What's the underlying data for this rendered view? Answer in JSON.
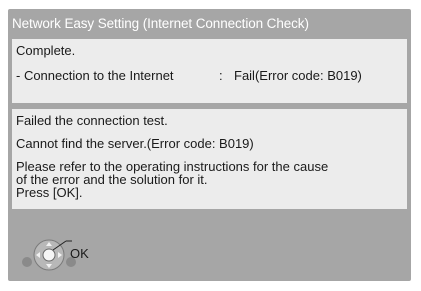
{
  "dialog": {
    "title": "Network Easy Setting (Internet Connection Check)"
  },
  "result_panel": {
    "status": "Complete.",
    "item_label": "- Connection to the Internet",
    "separator": ":",
    "item_value": "Fail(Error code: B019)"
  },
  "message_panel": {
    "line1": "Failed the connection test.",
    "line2": "Cannot find the server.(Error code: B019)",
    "line3": "Please refer to the operating instructions for the cause",
    "line4": "of the error and the solution for it.",
    "line5": "Press [OK]."
  },
  "footer": {
    "ok_label": "OK",
    "remote_icon": "remote-dpad-ok-icon"
  }
}
